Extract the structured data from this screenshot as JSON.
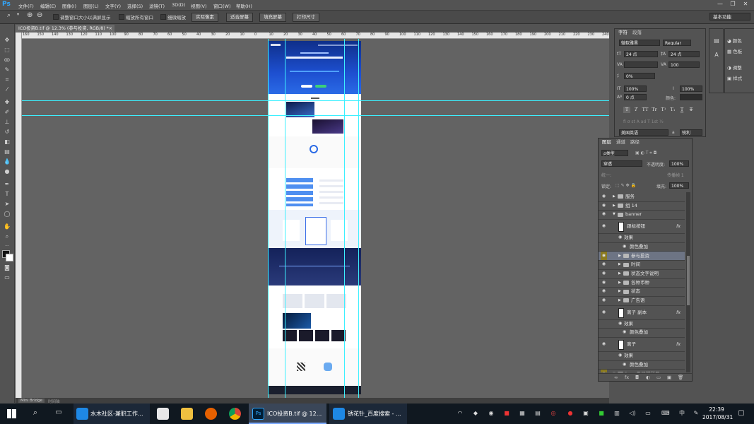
{
  "app": {
    "logo": "Ps",
    "menus": [
      "文件(F)",
      "编辑(E)",
      "图像(I)",
      "图层(L)",
      "文字(Y)",
      "选择(S)",
      "滤镜(T)",
      "3D(D)",
      "视图(V)",
      "窗口(W)",
      "帮助(H)"
    ],
    "window_controls": {
      "minimize": "—",
      "restore": "❐",
      "close": "✕"
    }
  },
  "options_bar": {
    "zoom_icon": "🔍",
    "checkbox_resize": "调整窗口大小以满屏显示",
    "checkbox_all_windows": "缩放所有窗口",
    "checkbox_scrubby": "细微缩放",
    "btn_actual": "实际像素",
    "btn_fit": "适合屏幕",
    "btn_fill": "填充屏幕",
    "btn_print": "打印尺寸",
    "workspace": "基本功能"
  },
  "document": {
    "tab_title": "ICO投资B.tif @ 12.3% (参与投资, RGB/8) *",
    "tab_close": "×",
    "ruler_marks": [
      "160",
      "150",
      "140",
      "130",
      "120",
      "110",
      "100",
      "90",
      "80",
      "70",
      "60",
      "50",
      "40",
      "30",
      "20",
      "10",
      "0",
      "10",
      "20",
      "30",
      "40",
      "50",
      "60",
      "70",
      "80",
      "90",
      "100",
      "110",
      "120",
      "130",
      "140",
      "150",
      "160",
      "170",
      "180",
      "190",
      "200",
      "210",
      "220",
      "230",
      "240"
    ]
  },
  "status_bar": {
    "mini_bridge": "Mini Bridge",
    "timeline": "时间轴"
  },
  "character_panel": {
    "tab_character": "字符",
    "tab_paragraph": "段落",
    "font_family": "微软雅黑",
    "font_style": "Regular",
    "font_size": "24 点",
    "leading": "24 点",
    "kerning": "",
    "tracking": "100",
    "scale_pct": "0%",
    "vertical_scale": "100%",
    "horizontal_scale": "100%",
    "baseline_shift": "0 点",
    "color_label": "颜色:",
    "type_buttons": [
      "T",
      "T",
      "TT",
      "Tr",
      "T¹",
      "T₁",
      "T",
      "T"
    ],
    "language": "美国英语",
    "aa_label": "a",
    "antialias": "锐利"
  },
  "right_panels": {
    "color": "颜色",
    "swatches": "色板",
    "adjustments": "调整",
    "styles": "样式"
  },
  "layers_panel": {
    "tab_layers": "图层",
    "tab_channels": "通道",
    "tab_paths": "路径",
    "filter_kind": "ρ类型",
    "blend_mode": "穿透",
    "opacity_label": "不透明度:",
    "opacity": "100%",
    "unify_label": "统一:",
    "propagate_label": "传播帧 1",
    "lock_label": "锁定:",
    "fill_label": "填充:",
    "fill": "100%",
    "rows": [
      {
        "name": "服务",
        "type": "group",
        "indent": 0
      },
      {
        "name": "组 14",
        "type": "group",
        "indent": 0
      },
      {
        "name": "banner",
        "type": "group-open",
        "indent": 0
      },
      {
        "name": "跟标按钮",
        "type": "layer-fx",
        "indent": 1
      },
      {
        "name": "效果",
        "type": "effect",
        "indent": 2
      },
      {
        "name": "颜色叠加",
        "type": "effect-item",
        "indent": 3
      },
      {
        "name": "参与投资",
        "type": "group-selected",
        "indent": 1
      },
      {
        "name": "时间",
        "type": "group",
        "indent": 1
      },
      {
        "name": "状态文字说明",
        "type": "group",
        "indent": 1
      },
      {
        "name": "各种币种",
        "type": "group",
        "indent": 1
      },
      {
        "name": "状态",
        "type": "group",
        "indent": 1
      },
      {
        "name": "广告语",
        "type": "group",
        "indent": 1
      },
      {
        "name": "离子 副本",
        "type": "layer-fx",
        "indent": 1
      },
      {
        "name": "效果",
        "type": "effect",
        "indent": 2
      },
      {
        "name": "颜色叠加",
        "type": "effect-item",
        "indent": 3
      },
      {
        "name": "离子",
        "type": "layer-fx",
        "indent": 1
      },
      {
        "name": "效果",
        "type": "effect",
        "indent": 2
      },
      {
        "name": "颜色叠加",
        "type": "effect-item",
        "indent": 3
      },
      {
        "name": "logo 及导航栏目",
        "type": "group-open",
        "indent": 0
      }
    ],
    "fx_mark": "fx",
    "bottom_icons": [
      "∞",
      "fx",
      "◘",
      "◐",
      "▭",
      "▣",
      "🗑"
    ]
  },
  "taskbar": {
    "tasks": [
      {
        "label": "水木社区-兼职工作...",
        "icon_color": "#1e88e5"
      },
      {
        "label": "ICO投资B.tif @ 12...",
        "icon_color": "#001e36"
      },
      {
        "label": "锈花针_百度搜索 - ...",
        "icon_color": "#1e88e5"
      }
    ],
    "time": "22:39",
    "date": "2017/08/31",
    "ime": "中"
  },
  "colors": {
    "ps_blue": "#31a8ff",
    "guide": "#3cf0ff",
    "banner_blue": "#1743b8",
    "selected_row": "#6d7484"
  }
}
